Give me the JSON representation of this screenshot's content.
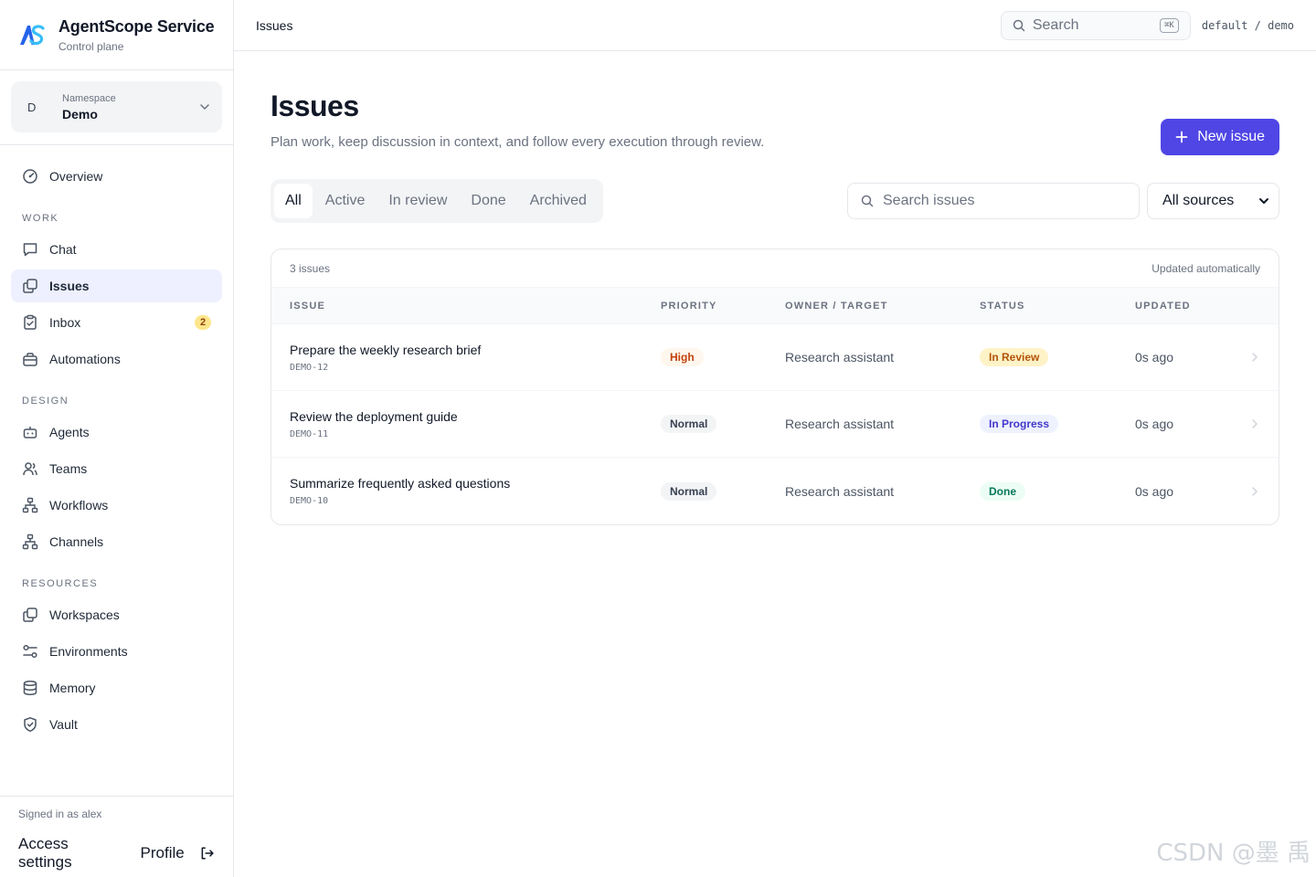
{
  "brand": {
    "title": "AgentScope Service",
    "subtitle": "Control plane"
  },
  "namespace": {
    "label": "Namespace",
    "value": "Demo",
    "avatar": "D"
  },
  "nav": {
    "overview": "Overview",
    "work_title": "WORK",
    "work": [
      {
        "label": "Chat",
        "icon": "chat-icon"
      },
      {
        "label": "Issues",
        "icon": "issues-icon",
        "active": true
      },
      {
        "label": "Inbox",
        "icon": "inbox-icon",
        "badge": "2"
      },
      {
        "label": "Automations",
        "icon": "automations-icon"
      }
    ],
    "design_title": "DESIGN",
    "design": [
      {
        "label": "Agents",
        "icon": "agent-icon"
      },
      {
        "label": "Teams",
        "icon": "teams-icon"
      },
      {
        "label": "Workflows",
        "icon": "workflow-icon"
      },
      {
        "label": "Channels",
        "icon": "channel-icon"
      }
    ],
    "resources_title": "RESOURCES",
    "resources": [
      {
        "label": "Workspaces",
        "icon": "workspace-icon"
      },
      {
        "label": "Environments",
        "icon": "environment-icon"
      },
      {
        "label": "Memory",
        "icon": "memory-icon"
      },
      {
        "label": "Vault",
        "icon": "vault-icon"
      }
    ]
  },
  "footer": {
    "signed_in": "Signed in as alex",
    "access_settings": "Access settings",
    "profile": "Profile"
  },
  "topbar": {
    "breadcrumb": "Issues",
    "search_placeholder": "Search",
    "shortcut": "⌘K",
    "context": "default / demo"
  },
  "page": {
    "title": "Issues",
    "subtitle": "Plan work, keep discussion in context, and follow every execution through review.",
    "new_button": "New issue"
  },
  "tabs": [
    "All",
    "Active",
    "In review",
    "Done",
    "Archived"
  ],
  "filters": {
    "search_placeholder": "Search issues",
    "source": "All sources"
  },
  "table": {
    "count": "3 issues",
    "updated_note": "Updated automatically",
    "columns": [
      "ISSUE",
      "PRIORITY",
      "OWNER / TARGET",
      "STATUS",
      "UPDATED"
    ],
    "rows": [
      {
        "title": "Prepare the weekly research brief",
        "id": "DEMO-12",
        "priority": "High",
        "owner": "Research assistant",
        "status": "In Review",
        "updated": "0s ago"
      },
      {
        "title": "Review the deployment guide",
        "id": "DEMO-11",
        "priority": "Normal",
        "owner": "Research assistant",
        "status": "In Progress",
        "updated": "0s ago"
      },
      {
        "title": "Summarize frequently asked questions",
        "id": "DEMO-10",
        "priority": "Normal",
        "owner": "Research assistant",
        "status": "Done",
        "updated": "0s ago"
      }
    ]
  },
  "watermark": "CSDN @墨 禹",
  "colors": {
    "accent": "#4f46e5",
    "active_nav_bg": "#eef0ff"
  }
}
